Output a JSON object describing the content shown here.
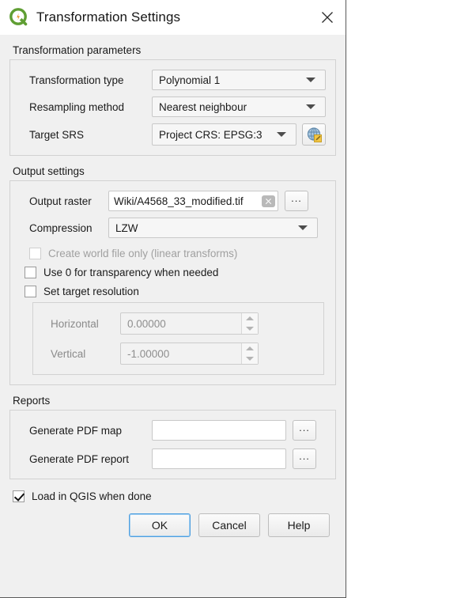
{
  "window": {
    "title": "Transformation Settings",
    "logo_icon": "qgis-logo-icon",
    "close_icon": "close-icon"
  },
  "transformation_parameters": {
    "group_title": "Transformation parameters",
    "rows": [
      {
        "label": "Transformation type",
        "value": "Polynomial 1",
        "widget": "combobox"
      },
      {
        "label": "Resampling method",
        "value": "Nearest neighbour",
        "widget": "combobox"
      },
      {
        "label": "Target SRS",
        "value": "Project CRS: EPSG:3",
        "widget": "combobox",
        "button_icon": "crs-globe-icon"
      }
    ]
  },
  "output_settings": {
    "group_title": "Output settings",
    "output_raster": {
      "label": "Output raster",
      "value": "Wiki/A4568_33_modified.tif",
      "clear_icon": "clear-icon",
      "browse_label": "..."
    },
    "compression": {
      "label": "Compression",
      "value": "LZW"
    },
    "checkboxes": [
      {
        "label": "Create world file only (linear transforms)",
        "checked": false,
        "disabled": true
      },
      {
        "label": "Use 0 for transparency when needed",
        "checked": false,
        "disabled": false
      },
      {
        "label": "Set target resolution",
        "checked": false,
        "disabled": false
      }
    ],
    "resolution": {
      "horizontal": {
        "label": "Horizontal",
        "value": "0.00000",
        "disabled": true
      },
      "vertical": {
        "label": "Vertical",
        "value": "-1.00000",
        "disabled": true
      }
    }
  },
  "reports": {
    "group_title": "Reports",
    "rows": [
      {
        "label": "Generate PDF map",
        "value": "",
        "browse_label": "..."
      },
      {
        "label": "Generate PDF report",
        "value": "",
        "browse_label": "..."
      }
    ]
  },
  "footer": {
    "load_checkbox": {
      "label": "Load in QGIS when done",
      "checked": true
    },
    "buttons": [
      {
        "label": "OK",
        "default": true
      },
      {
        "label": "Cancel",
        "default": false
      },
      {
        "label": "Help",
        "default": false
      }
    ]
  },
  "colors": {
    "dialog_bg": "#f0f0f0",
    "titlebar_bg": "#ffffff",
    "accent_focus": "#4f9fe0",
    "qgis_green": "#589632",
    "qgis_orange": "#e8962d",
    "disabled_text": "#a0a0a0"
  }
}
